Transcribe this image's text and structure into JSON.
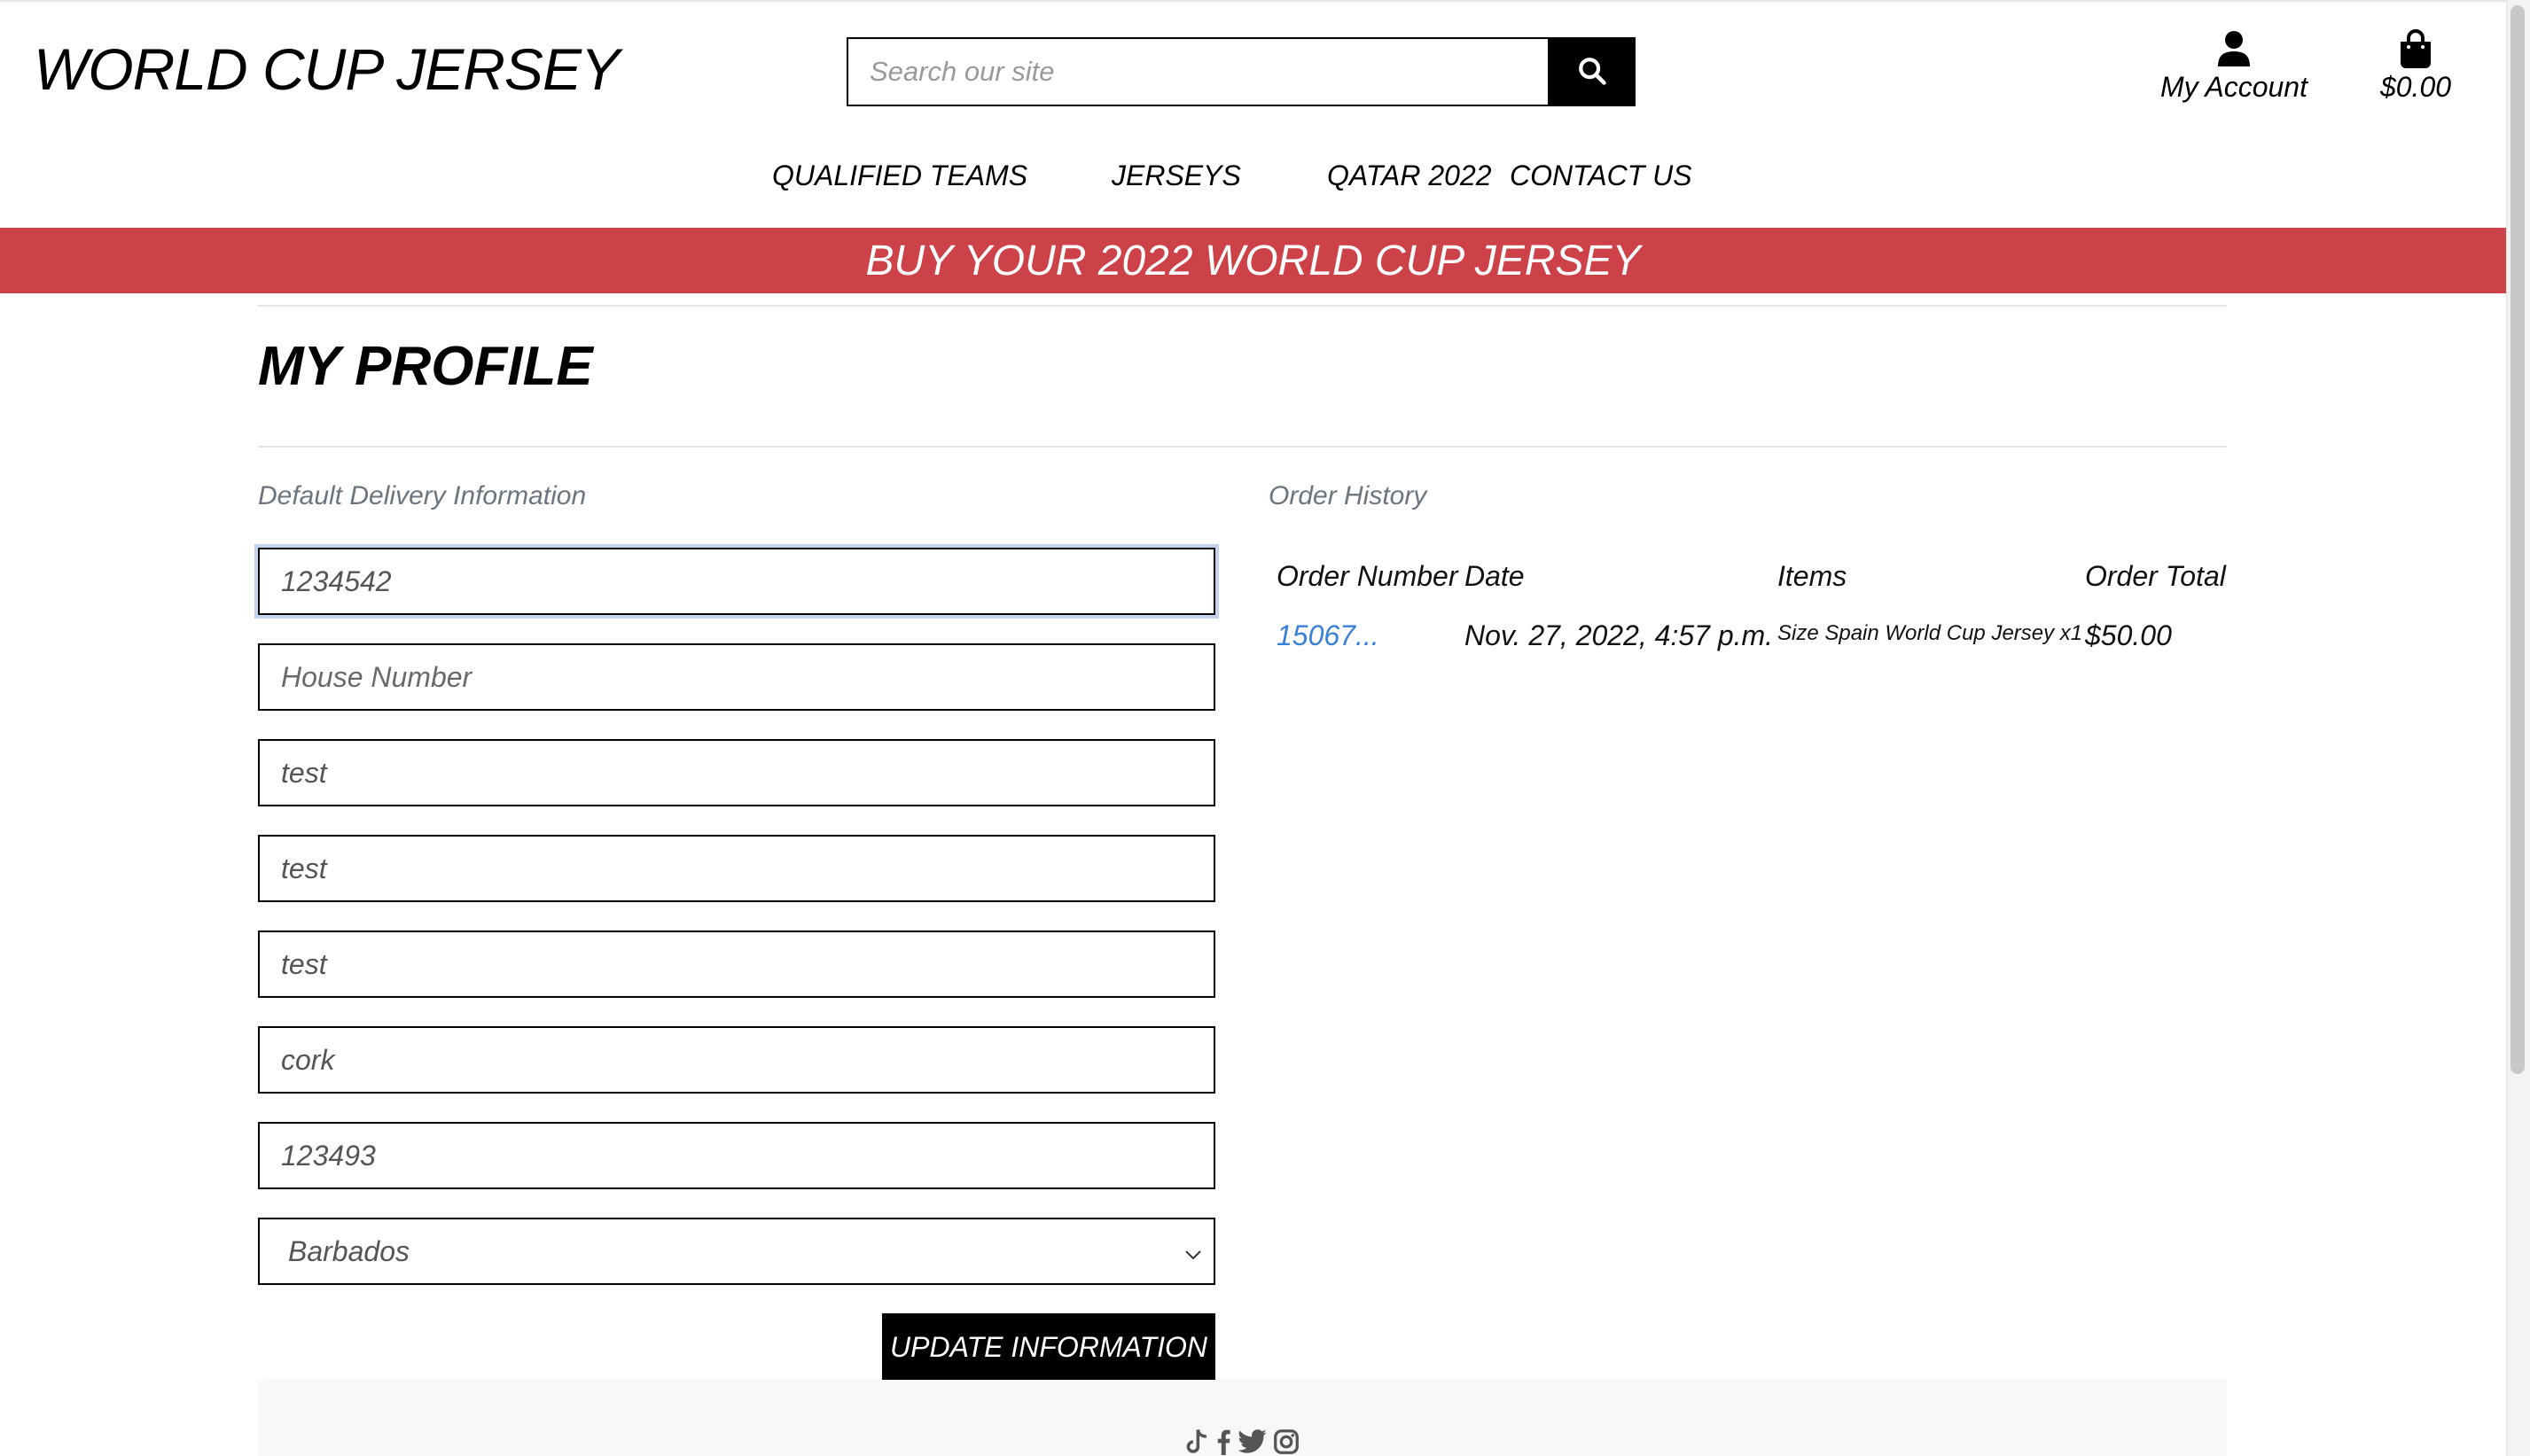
{
  "header": {
    "brand": "WORLD CUP JERSEY",
    "search_placeholder": "Search our site",
    "account_label": "My Account",
    "cart_total": "$0.00"
  },
  "nav": {
    "items": [
      {
        "label": "QUALIFIED TEAMS"
      },
      {
        "label": "JERSEYS"
      },
      {
        "label": "QATAR 2022"
      },
      {
        "label": "CONTACT US"
      }
    ]
  },
  "banner": {
    "text": "BUY YOUR 2022 WORLD CUP JERSEY",
    "color": "#cc4248"
  },
  "profile": {
    "title": "MY PROFILE",
    "delivery_label": "Default Delivery Information",
    "fields": [
      {
        "value": "1234542",
        "placeholder": ""
      },
      {
        "value": "",
        "placeholder": "House Number"
      },
      {
        "value": "test",
        "placeholder": ""
      },
      {
        "value": "test",
        "placeholder": ""
      },
      {
        "value": "test",
        "placeholder": ""
      },
      {
        "value": "cork",
        "placeholder": ""
      },
      {
        "value": "123493",
        "placeholder": ""
      }
    ],
    "country_selected": "Barbados",
    "update_button": "UPDATE INFORMATION"
  },
  "order_history": {
    "label": "Order History",
    "columns": [
      "Order Number",
      "Date",
      "Items",
      "Order Total"
    ],
    "rows": [
      {
        "order_number": "15067...",
        "date": "Nov. 27, 2022, 4:57 p.m.",
        "items": "Size Spain World Cup Jersey x1",
        "total": "$50.00"
      }
    ]
  },
  "footer": {
    "social_icons": [
      "tiktok-icon",
      "facebook-icon",
      "twitter-icon",
      "instagram-icon"
    ]
  },
  "colors": {
    "accent": "#cc4248",
    "link": "#3a7fd6",
    "muted_text": "#6c757d",
    "footer_bg": "#f7f8f9"
  }
}
